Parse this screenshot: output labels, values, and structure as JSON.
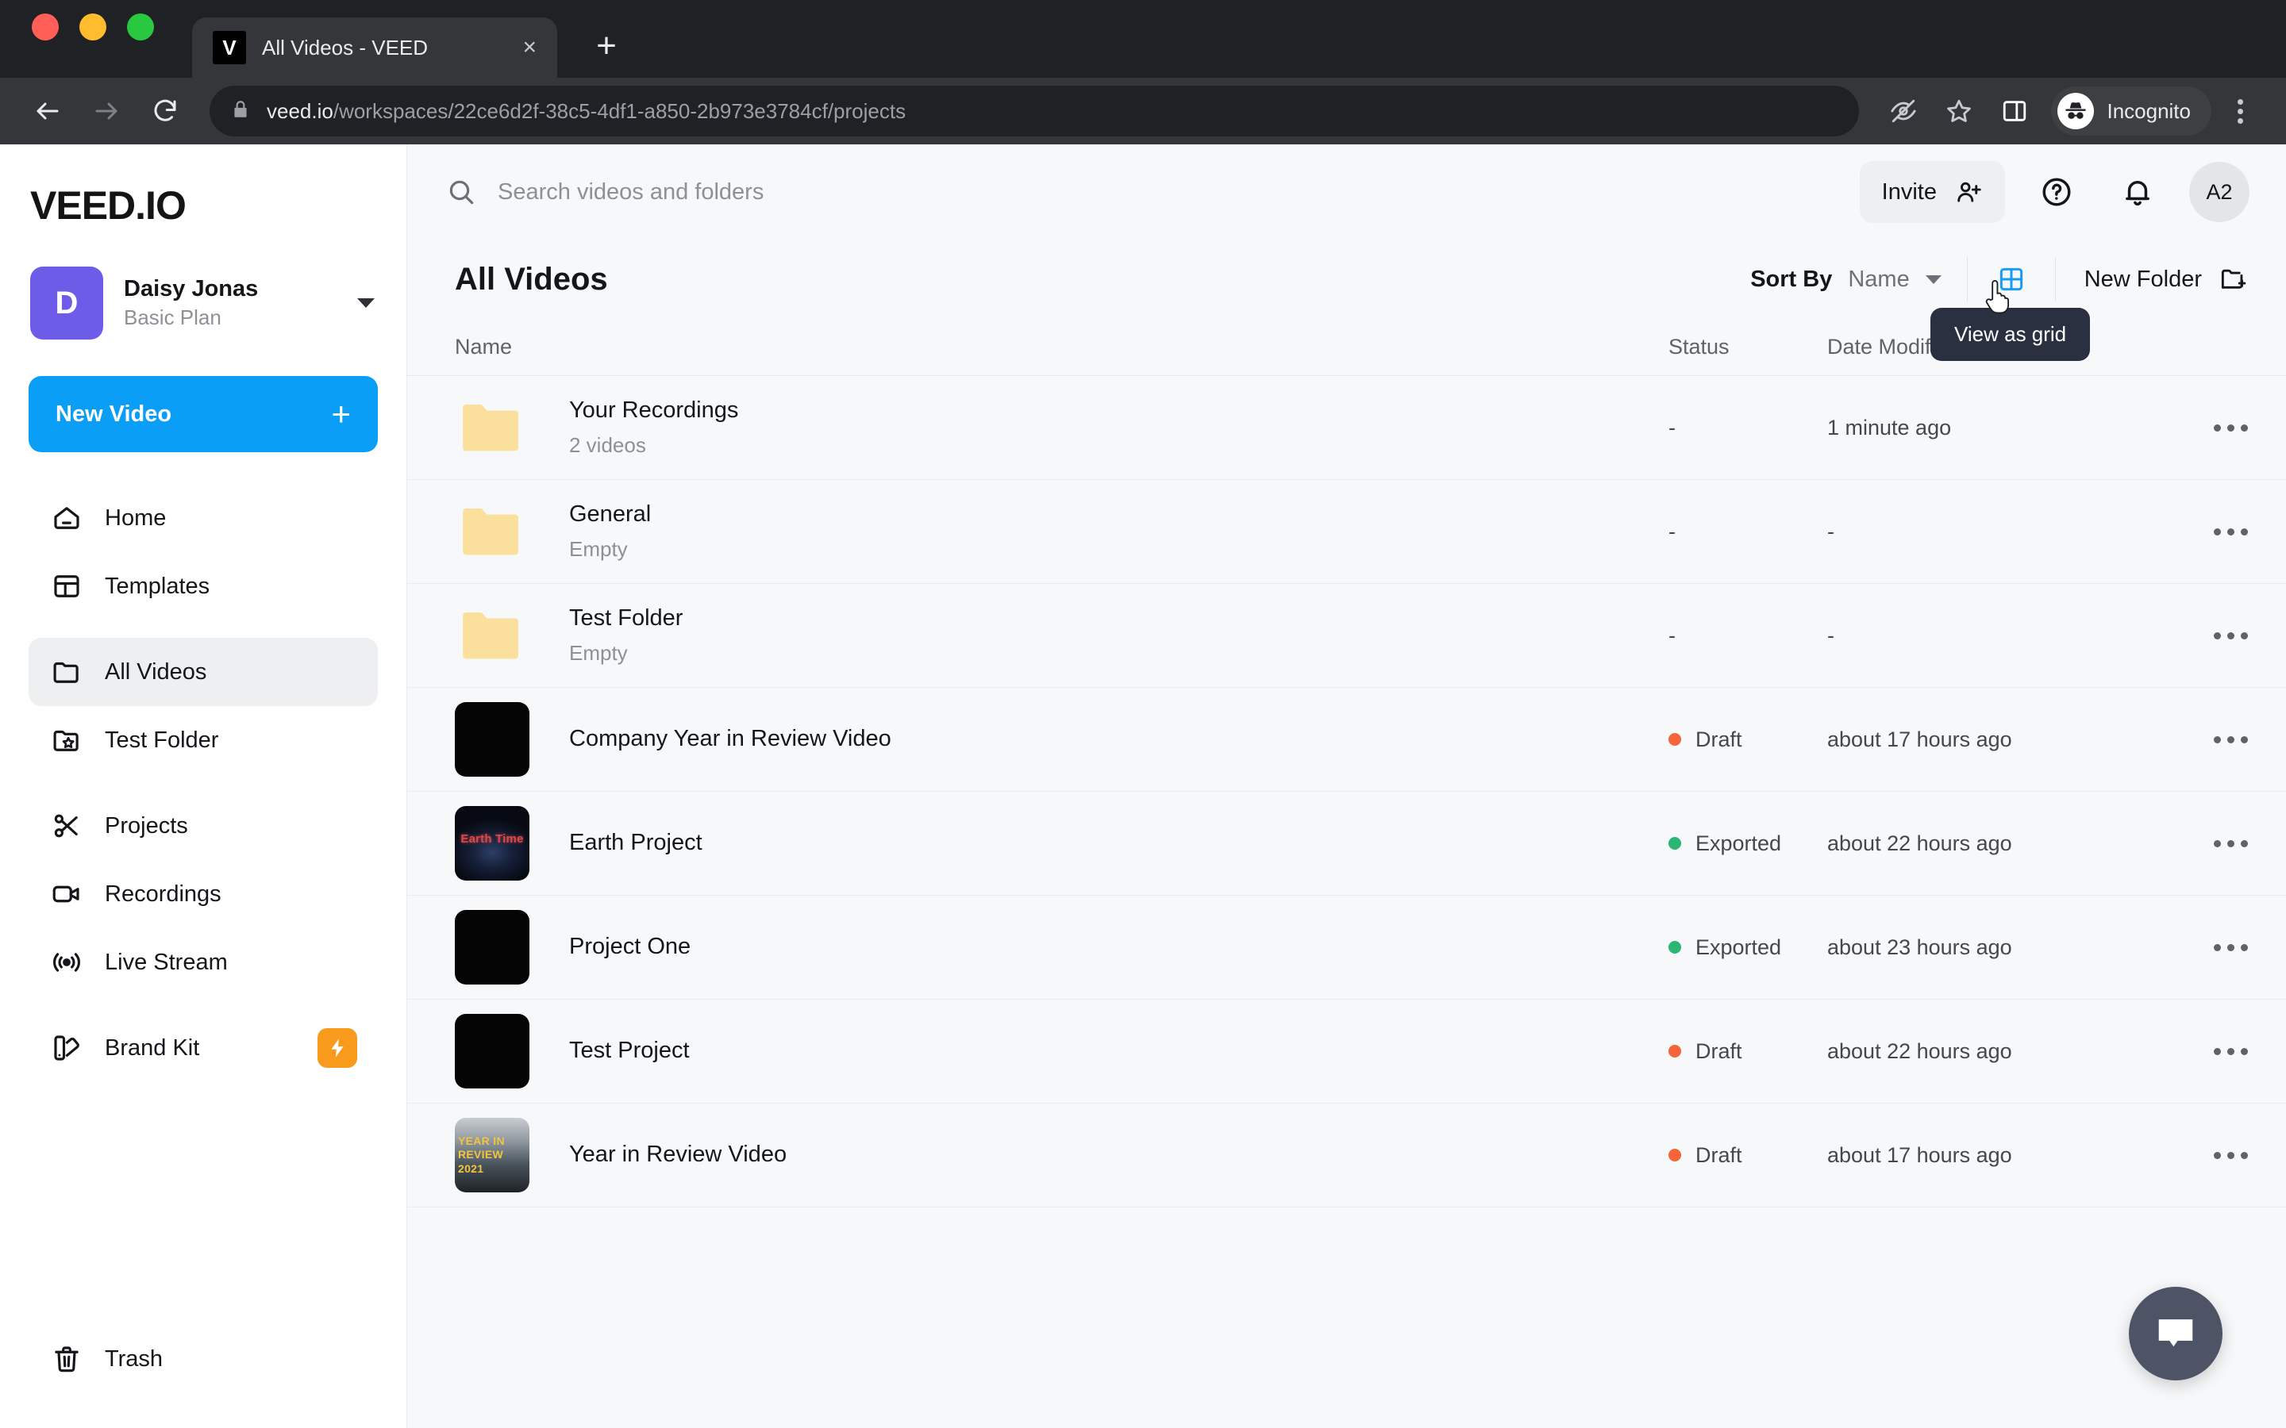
{
  "browser": {
    "tab": {
      "title": "All Videos - VEED",
      "favicon_letter": "V",
      "close_label": "×"
    },
    "new_tab_label": "+",
    "url_domain": "veed.io",
    "url_path": "/workspaces/22ce6d2f-38c5-4df1-a850-2b973e3784cf/projects",
    "profile_label": "Incognito",
    "icons": {
      "back": "back-arrow-icon",
      "forward": "forward-arrow-icon",
      "reload": "reload-icon",
      "lock": "lock-icon",
      "third_party_cookies": "eye-slash-icon",
      "bookmark": "star-icon",
      "side_panel": "side-panel-icon",
      "incognito": "incognito-icon",
      "menu": "three-dots-vertical-icon"
    }
  },
  "sidebar": {
    "logo": "VEED.IO",
    "account": {
      "initial": "D",
      "name": "Daisy Jonas",
      "plan": "Basic Plan"
    },
    "new_video_label": "New Video",
    "new_video_plus": "+",
    "items": [
      {
        "label": "Home",
        "icon": "home-icon",
        "active": false
      },
      {
        "label": "Templates",
        "icon": "templates-icon",
        "active": false
      },
      {
        "label": "All Videos",
        "icon": "folder-icon",
        "active": true
      },
      {
        "label": "Test Folder",
        "icon": "folder-star-icon",
        "active": false
      },
      {
        "label": "Projects",
        "icon": "scissors-icon",
        "active": false
      },
      {
        "label": "Recordings",
        "icon": "video-camera-icon",
        "active": false
      },
      {
        "label": "Live Stream",
        "icon": "broadcast-icon",
        "active": false
      },
      {
        "label": "Brand Kit",
        "icon": "brand-kit-icon",
        "active": false,
        "badge": "bolt-icon"
      },
      {
        "label": "Trash",
        "icon": "trash-icon",
        "active": false
      }
    ]
  },
  "header": {
    "search_placeholder": "Search videos and folders",
    "invite_label": "Invite",
    "help_icon": "question-circle-icon",
    "bell_icon": "bell-icon",
    "avatar_initials": "A2"
  },
  "toolbar": {
    "page_title": "All Videos",
    "sort_by_label": "Sort By",
    "sort_by_value": "Name",
    "grid_toggle_icon": "grid-view-icon",
    "grid_toggle_color": "#1a9cf5",
    "new_folder_label": "New Folder",
    "tooltip_text": "View as grid"
  },
  "table": {
    "columns": {
      "name": "Name",
      "status": "Status",
      "date": "Date Modified"
    },
    "rows": [
      {
        "kind": "folder",
        "name": "Your Recordings",
        "sub": "2 videos",
        "status": "",
        "status_dash": "-",
        "date": "1 minute ago",
        "thumb": "folder-thumb"
      },
      {
        "kind": "folder",
        "name": "General",
        "sub": "Empty",
        "status": "",
        "status_dash": "-",
        "date": "-",
        "thumb": "folder-thumb"
      },
      {
        "kind": "folder",
        "name": "Test Folder",
        "sub": "Empty",
        "status": "",
        "status_dash": "-",
        "date": "-",
        "thumb": "folder-thumb"
      },
      {
        "kind": "video",
        "name": "Company Year in Review Video",
        "sub": "",
        "status": "Draft",
        "status_color": "#f4663a",
        "date": "about 17 hours ago",
        "thumb": "black-thumb"
      },
      {
        "kind": "video",
        "name": "Earth Project",
        "sub": "",
        "status": "Exported",
        "status_color": "#2bb673",
        "date": "about 22 hours ago",
        "thumb": "earth-thumb",
        "thumb_text": "Earth Time"
      },
      {
        "kind": "video",
        "name": "Project One",
        "sub": "",
        "status": "Exported",
        "status_color": "#2bb673",
        "date": "about 23 hours ago",
        "thumb": "black-thumb"
      },
      {
        "kind": "video",
        "name": "Test Project",
        "sub": "",
        "status": "Draft",
        "status_color": "#f4663a",
        "date": "about 22 hours ago",
        "thumb": "black-thumb"
      },
      {
        "kind": "video",
        "name": "Year in Review Video",
        "sub": "",
        "status": "Draft",
        "status_color": "#f4663a",
        "date": "about 17 hours ago",
        "thumb": "yir-thumb",
        "thumb_lines": [
          "YEAR IN",
          "REVIEW",
          "2021"
        ]
      }
    ]
  },
  "chat": {
    "icon": "chat-bubble-icon"
  }
}
